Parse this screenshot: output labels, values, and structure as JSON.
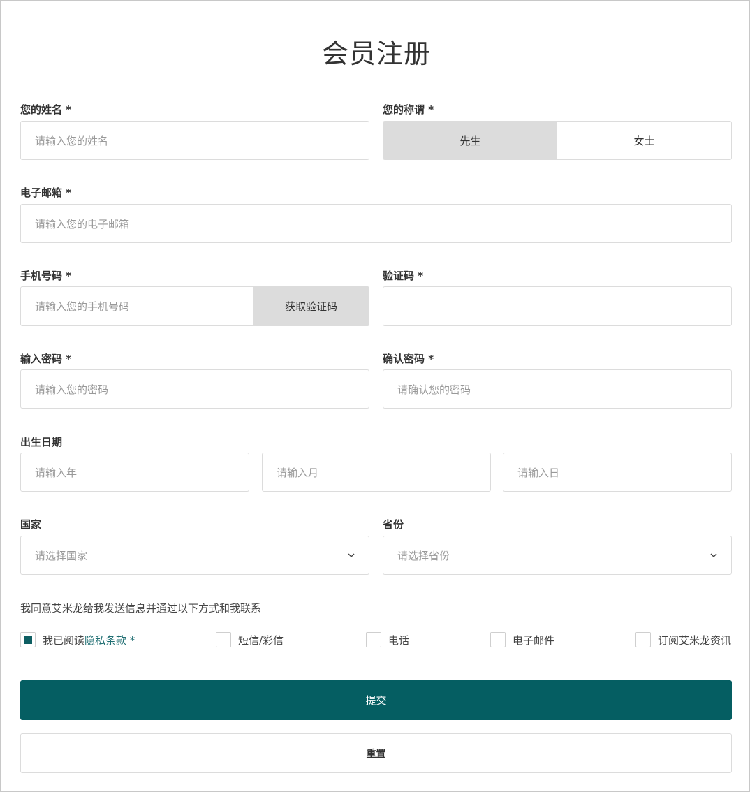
{
  "title": "会员注册",
  "name": {
    "label": "您的姓名 *",
    "placeholder": "请输入您的姓名"
  },
  "salutation": {
    "label": "您的称谓 *",
    "options": [
      "先生",
      "女士"
    ],
    "selected": "先生"
  },
  "email": {
    "label": "电子邮箱 *",
    "placeholder": "请输入您的电子邮箱"
  },
  "phone": {
    "label": "手机号码 *",
    "placeholder": "请输入您的手机号码",
    "get_code_label": "获取验证码"
  },
  "code": {
    "label": "验证码 *",
    "placeholder": ""
  },
  "password": {
    "label": "输入密码 *",
    "placeholder": "请输入您的密码"
  },
  "confirm_password": {
    "label": "确认密码 *",
    "placeholder": "请确认您的密码"
  },
  "birthdate": {
    "label": "出生日期",
    "year_placeholder": "请输入年",
    "month_placeholder": "请输入月",
    "day_placeholder": "请输入日"
  },
  "country": {
    "label": "国家",
    "placeholder": "请选择国家",
    "icon": "chevron-down-icon"
  },
  "province": {
    "label": "省份",
    "placeholder": "请选择省份",
    "icon": "chevron-down-icon"
  },
  "consent_text": "我同意艾米龙给我发送信息并通过以下方式和我联系",
  "checkboxes": {
    "privacy": {
      "prefix": "我已阅读",
      "link": "隐私条款 *",
      "checked": true
    },
    "sms": {
      "label": "短信/彩信",
      "checked": false
    },
    "phone": {
      "label": "电话",
      "checked": false
    },
    "email": {
      "label": "电子邮件",
      "checked": false
    },
    "newsletter": {
      "label": "订阅艾米龙资讯",
      "checked": false
    }
  },
  "submit_label": "提交",
  "reset_label": "重置",
  "colors": {
    "primary": "#055e62",
    "segment_active": "#dcdcdc",
    "border": "#dcdcdc"
  }
}
